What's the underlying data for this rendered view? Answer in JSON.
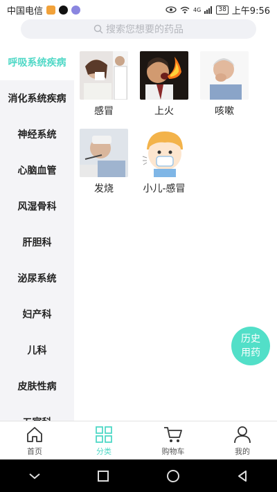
{
  "status": {
    "carrier": "中国电信",
    "battery": "38",
    "time": "上午9:56",
    "network": "4G"
  },
  "search": {
    "placeholder": "搜索您想要的药品"
  },
  "categories": [
    "呼吸系统疾病",
    "消化系统疾病",
    "神经系统",
    "心脑血管",
    "风湿骨科",
    "肝胆科",
    "泌尿系统",
    "妇产科",
    "儿科",
    "皮肤性病",
    "五官科"
  ],
  "active_category": "呼吸系统疾病",
  "items": [
    {
      "label": "感冒",
      "icon": "cold-photo"
    },
    {
      "label": "上火",
      "icon": "fire-photo"
    },
    {
      "label": "咳嗽",
      "icon": "cough-photo"
    },
    {
      "label": "发烧",
      "icon": "fever-photo"
    },
    {
      "label": "小儿-感冒",
      "icon": "child-cold-illustration"
    }
  ],
  "fab": {
    "line1": "历史",
    "line2": "用药"
  },
  "tabs": [
    {
      "label": "首页",
      "icon": "home-icon"
    },
    {
      "label": "分类",
      "icon": "category-icon"
    },
    {
      "label": "购物车",
      "icon": "cart-icon"
    },
    {
      "label": "我的",
      "icon": "profile-icon"
    }
  ],
  "active_tab": "分类",
  "colors": {
    "accent": "#4fd8c6",
    "fab": "#52dfc8",
    "sidebar_bg": "#f4f4f7",
    "search_bg": "#f0f1f5"
  }
}
